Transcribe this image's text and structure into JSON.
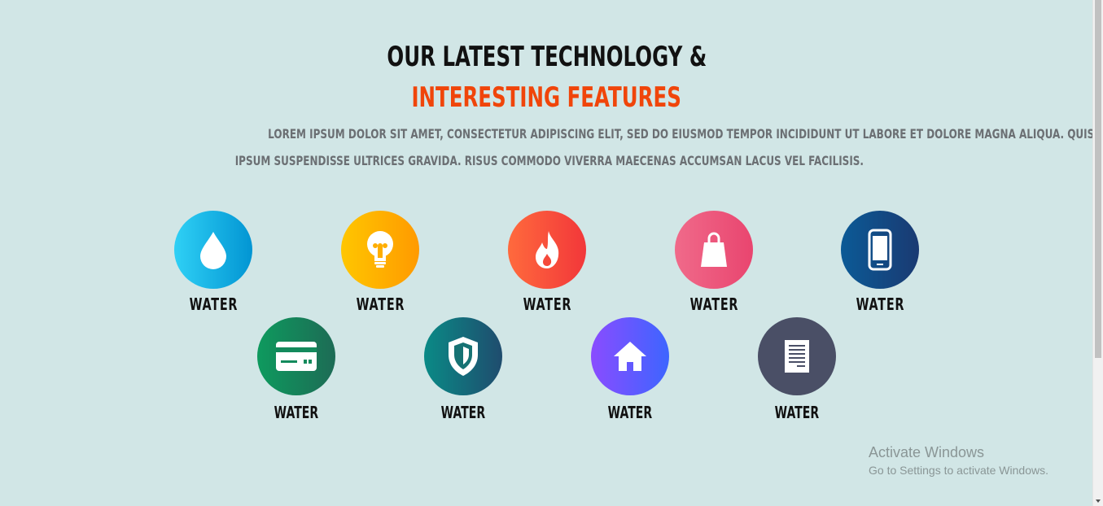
{
  "header": {
    "title_line1": "OUR LATEST TECHNOLOGY &",
    "title_line2": "INTERESTING FEATURES",
    "desc_line1": "LOREM IPSUM DOLOR SIT AMET, CONSECTETUR ADIPISCING ELIT, SED DO EIUSMOD TEMPOR INCIDIDUNT UT LABORE ET DOLORE MAGNA ALIQUA. QUIS",
    "desc_line2": "IPSUM SUSPENDISSE ULTRICES GRAVIDA. RISUS COMMODO VIVERRA MAECENAS ACCUMSAN LACUS VEL FACILISIS.",
    "title_accent_color": "#f0450a"
  },
  "features_row1": [
    {
      "label": "WATER",
      "icon": "water-drop-icon",
      "gradient": [
        "#2fd0f5",
        "#0295d3"
      ]
    },
    {
      "label": "WATER",
      "icon": "light-bulb-icon",
      "gradient": [
        "#ffc600",
        "#ff9a00"
      ]
    },
    {
      "label": "WATER",
      "icon": "flame-icon",
      "gradient": [
        "#ff6a3d",
        "#f2373a"
      ]
    },
    {
      "label": "WATER",
      "icon": "shopping-bag-icon",
      "gradient": [
        "#f06a8a",
        "#e9456f"
      ]
    },
    {
      "label": "WATER",
      "icon": "smartphone-icon",
      "gradient": [
        "#0b5a96",
        "#1a3a72"
      ]
    }
  ],
  "features_row2": [
    {
      "label": "WATER",
      "icon": "credit-card-icon",
      "gradient": [
        "#0e9a5e",
        "#1d6b55"
      ]
    },
    {
      "label": "WATER",
      "icon": "shield-icon",
      "gradient": [
        "#0a8a86",
        "#1f4c6e"
      ]
    },
    {
      "label": "WATER",
      "icon": "home-icon",
      "gradient": [
        "#8a4cff",
        "#3d65ff"
      ]
    },
    {
      "label": "WATER",
      "icon": "document-icon",
      "gradient": [
        "#4a4f66",
        "#4a4f66"
      ]
    }
  ],
  "watermark": {
    "line1": "Activate Windows",
    "line2": "Go to Settings to activate Windows."
  }
}
